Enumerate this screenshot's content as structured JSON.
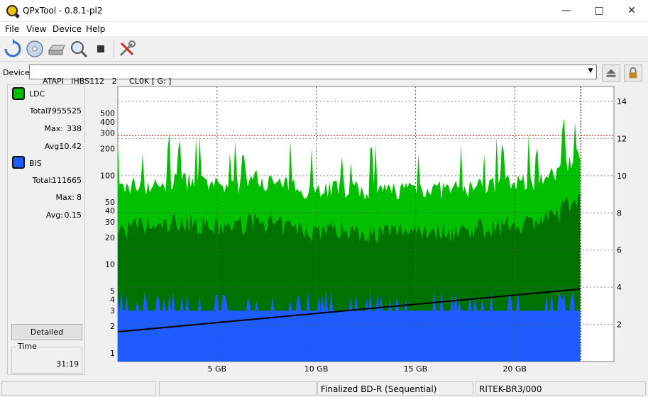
{
  "window": {
    "title": "QPxTool - 0.8.1-pl2"
  },
  "menu": [
    "File",
    "View",
    "Device",
    "Help"
  ],
  "toolbar_icons": [
    "refresh-icon",
    "disc-icon",
    "drive-icon",
    "scan-icon",
    "stop-icon",
    "settings-tools-icon"
  ],
  "device": {
    "label": "Device:",
    "value": "ATAPI   iHBS112   2     CL0K [ G: ]"
  },
  "legend": {
    "ldc": {
      "name": "LDC",
      "color": "#00c000",
      "total_label": "Total:",
      "total": "7955525",
      "max_label": "Max:",
      "max": "338",
      "avg_label": "Avg:",
      "avg": "10.42"
    },
    "bis": {
      "name": "BIS",
      "color": "#1e5cff",
      "total_label": "Total:",
      "total": "111665",
      "max_label": "Max:",
      "max": "8",
      "avg_label": "Avg:",
      "avg": "0.15"
    }
  },
  "detailed_label": "Detailed",
  "time": {
    "label": "Time",
    "value": "31:19"
  },
  "status": {
    "disc": "Finalized BD-R (Sequential)",
    "media": "RITEK-BR3/000"
  },
  "chart_data": {
    "type": "area",
    "x_ticks": [
      "5 GB",
      "10 GB",
      "15 GB",
      "20 GB"
    ],
    "x_tick_values": [
      5,
      10,
      15,
      20
    ],
    "xlim": [
      0,
      25
    ],
    "y_left_ticks": [
      "1",
      "2",
      "3",
      "4",
      "5",
      "10",
      "20",
      "30",
      "40",
      "50",
      "100",
      "200",
      "300",
      "400",
      "500"
    ],
    "y_left_values": [
      1,
      2,
      3,
      4,
      5,
      10,
      20,
      30,
      40,
      50,
      100,
      200,
      300,
      400,
      500
    ],
    "y_left_scale": "log",
    "ylim_left": [
      0.8,
      1000
    ],
    "y_right_ticks": [
      "2",
      "4",
      "6",
      "8",
      "10",
      "12",
      "14"
    ],
    "y_right_values": [
      2,
      4,
      6,
      8,
      10,
      12,
      14
    ],
    "ylim_right": [
      0,
      14.8
    ],
    "grid": true,
    "threshold_line": 280,
    "series": [
      {
        "name": "LDC",
        "x": [
          0,
          1,
          2,
          3,
          4,
          5,
          6,
          7,
          8,
          9,
          10,
          11,
          12,
          13,
          14,
          15,
          16,
          17,
          18,
          19,
          20,
          21,
          22,
          23.3
        ],
        "values": [
          70,
          80,
          75,
          90,
          85,
          75,
          80,
          95,
          80,
          75,
          70,
          75,
          70,
          65,
          70,
          75,
          70,
          70,
          75,
          80,
          85,
          90,
          100,
          180
        ]
      },
      {
        "name": "BIS",
        "x": [
          0,
          23.3
        ],
        "values": [
          3,
          3
        ]
      },
      {
        "name": "Speed",
        "x": [
          0,
          23.3
        ],
        "values": [
          1.6,
          3.9
        ]
      }
    ]
  }
}
